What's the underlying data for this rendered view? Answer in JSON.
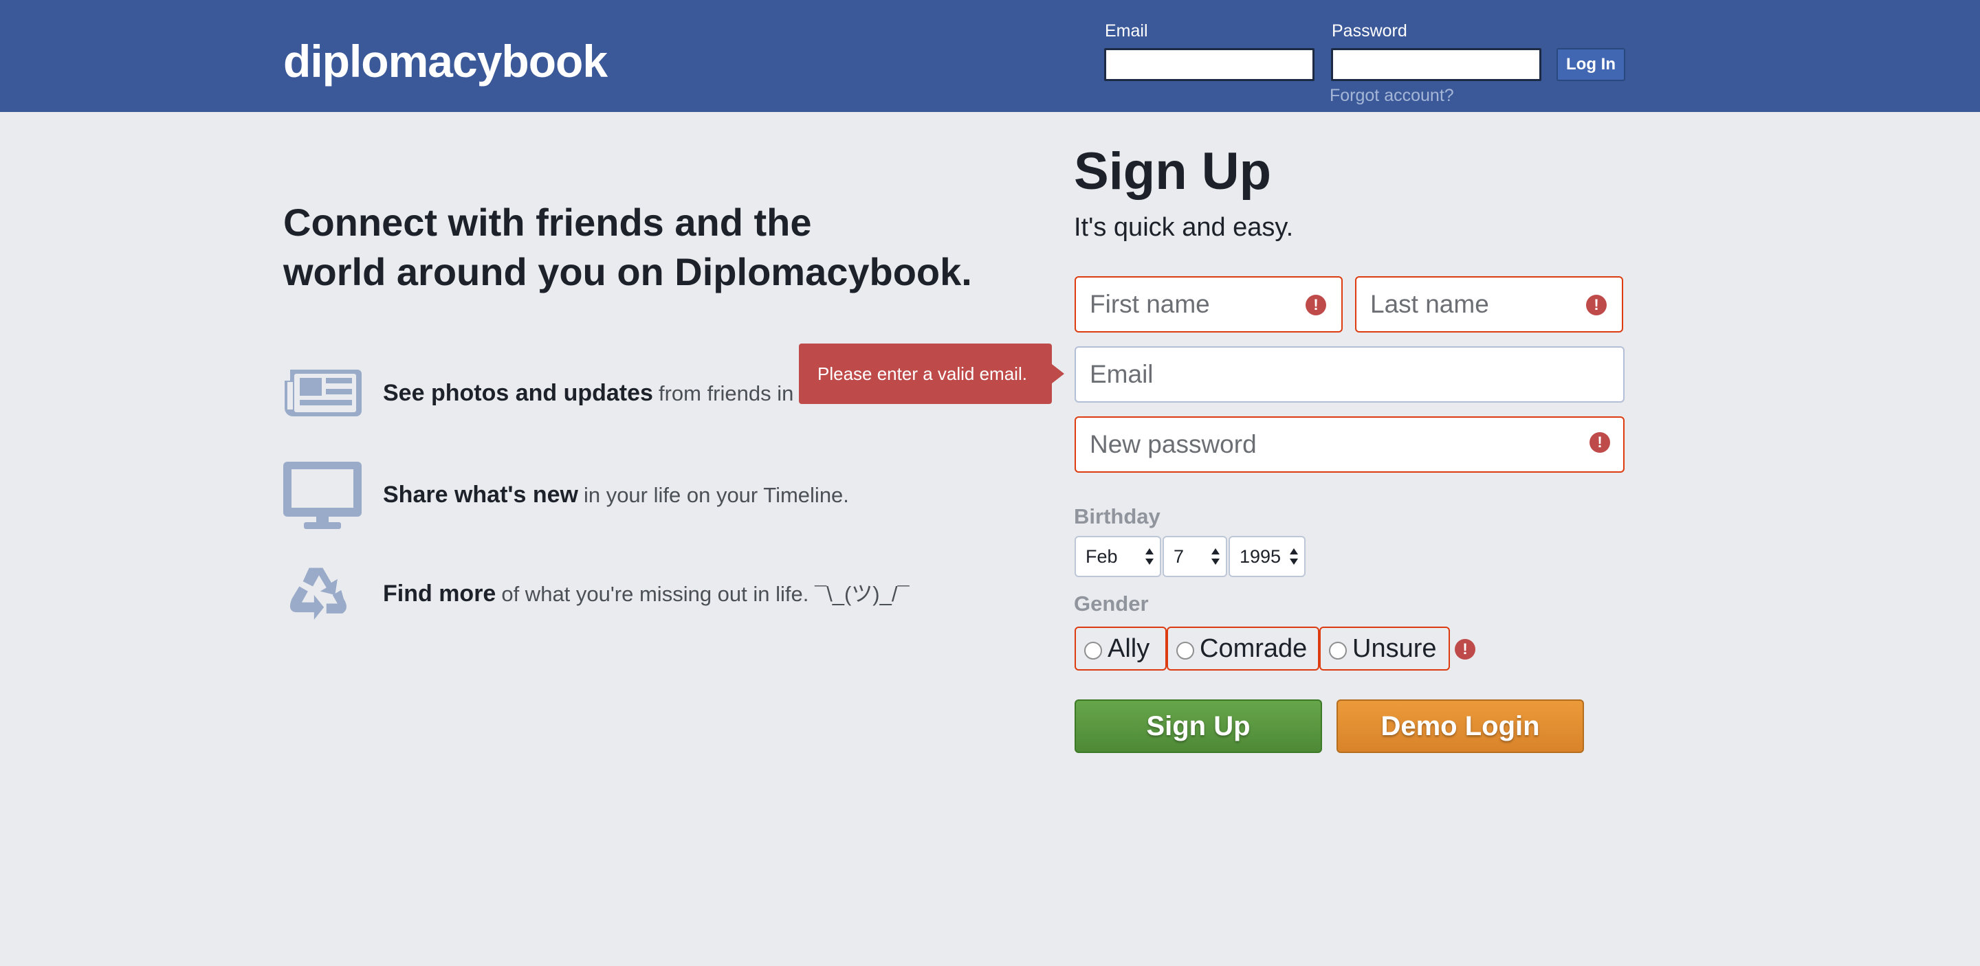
{
  "header": {
    "logo": "diplomacybook",
    "email_label": "Email",
    "password_label": "Password",
    "email_value": "",
    "password_value": "",
    "login_button": "Log In",
    "forgot_link": "Forgot account?",
    "background_color": "#3b5998"
  },
  "intro": {
    "headline_line1": "Connect with friends and the",
    "headline_line2": "world around you on Diplomacybook.",
    "features": [
      {
        "icon": "newspaper-icon",
        "strong": "See photos and updates",
        "light": "from friends in"
      },
      {
        "icon": "monitor-icon",
        "strong": "Share what's new",
        "light": "in your life on your Timeline."
      },
      {
        "icon": "recycle-icon",
        "strong": "Find more",
        "light": "of what you're missing out in life. ¯\\_(ツ)_/¯"
      }
    ]
  },
  "tooltip": {
    "message": "Please enter a valid email.",
    "color": "#be4b49"
  },
  "signup": {
    "title": "Sign Up",
    "subtitle": "It's quick and easy.",
    "first_name_placeholder": "First name",
    "last_name_placeholder": "Last name",
    "email_placeholder": "Email",
    "password_placeholder": "New password",
    "birthday_label": "Birthday",
    "birthday_month": "Feb",
    "birthday_day": "7",
    "birthday_year": "1995",
    "gender_label": "Gender",
    "gender_options": [
      "Ally",
      "Comrade",
      "Unsure"
    ],
    "signup_button": "Sign Up",
    "demo_button": "Demo Login",
    "error_color": "#dd3c10"
  }
}
